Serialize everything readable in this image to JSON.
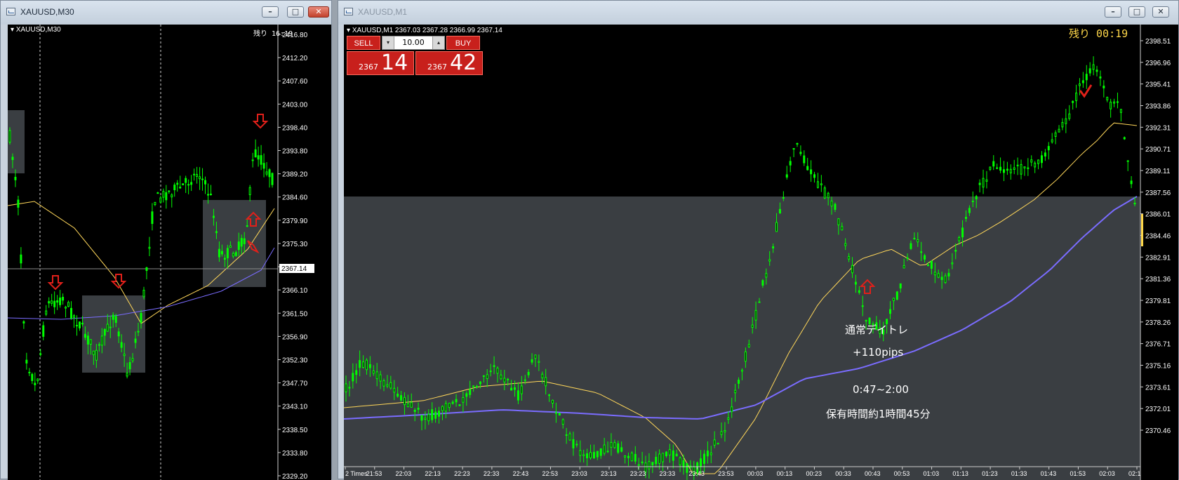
{
  "left_window": {
    "title": "XAUUSD,M30",
    "symbol_label": "XAUUSD,M30",
    "remaining_label": "残り 16:19",
    "price_levels": [
      "2416.80",
      "2412.20",
      "2407.60",
      "2403.00",
      "2398.40",
      "2393.80",
      "2389.20",
      "2384.60",
      "2379.90",
      "2375.30",
      "2370.70",
      "2366.10",
      "2361.50",
      "2356.90",
      "2352.30",
      "2347.70",
      "2343.10",
      "2338.50",
      "2333.80",
      "2329.20"
    ],
    "current_price": "2367.14",
    "controls": {
      "minimize": "–",
      "maximize": "□",
      "close": "✕"
    }
  },
  "right_window": {
    "title": "XAUUSD,M1",
    "symbol_info": "XAUUSD,M1  2367.03 2367.28 2366.99 2367.14",
    "remaining_label": "残り  00:19",
    "trade_panel": {
      "sell_label": "SELL",
      "buy_label": "BUY",
      "lot_value": "10.00",
      "sell_price_small": "2367",
      "sell_price_big": "14",
      "buy_price_small": "2367",
      "buy_price_big": "42"
    },
    "price_levels": [
      "2398.51",
      "2396.96",
      "2395.41",
      "2393.86",
      "2392.31",
      "2390.71",
      "2389.11",
      "2387.56",
      "2386.01",
      "2384.46",
      "2382.91",
      "2381.36",
      "2379.81",
      "2378.26",
      "2376.71",
      "2375.16",
      "2373.61",
      "2372.01",
      "2370.46"
    ],
    "time_labels": [
      "2 Times",
      "21:53",
      "22:03",
      "22:13",
      "22:23",
      "22:33",
      "22:43",
      "22:53",
      "23:03",
      "23:13",
      "23:23",
      "23:33",
      "23:43",
      "23:53",
      "00:03",
      "00:13",
      "00:23",
      "00:33",
      "00:43",
      "00:53",
      "01:03",
      "01:13",
      "01:23",
      "01:33",
      "01:43",
      "01:53",
      "02:03",
      "02:1"
    ],
    "annotations": {
      "trade_type": "通常デイトレ",
      "pips": "+110pips",
      "time_range": "0:47~2:00",
      "holding_time": "保有時間約1時間45分"
    },
    "controls": {
      "minimize": "–",
      "maximize": "□",
      "close": "✕"
    }
  },
  "colors": {
    "candle": "#00ff00",
    "ma_fast": "#ffd75a",
    "ma_slow": "#7a6cff",
    "arrow": "#e0201a",
    "zone": "#3a3e42",
    "chart_bg": "#000000"
  }
}
